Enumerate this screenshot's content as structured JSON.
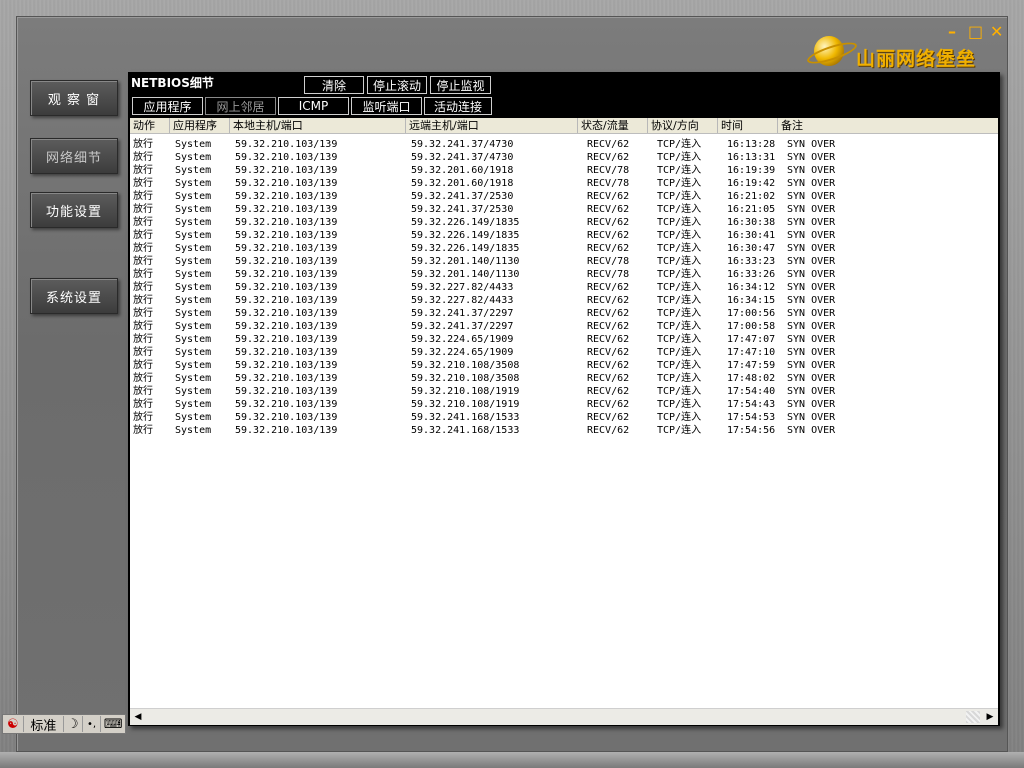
{
  "window": {
    "title_logo": "山丽网络堡垒",
    "controls": {
      "minimize": "–",
      "maximize": "□",
      "close": "✕"
    }
  },
  "sidebar": {
    "items": [
      {
        "label": "观 察 窗",
        "active": false
      },
      {
        "label": "网络细节",
        "active": true
      },
      {
        "label": "功能设置",
        "active": false
      },
      {
        "label": "系统设置",
        "active": false
      }
    ]
  },
  "panel": {
    "title": "NETBIOS细节",
    "toolbar": {
      "clear": "清除",
      "stop_scroll": "停止滚动",
      "stop_monitor": "停止监视"
    },
    "tabs": [
      "应用程序",
      "网上邻居",
      "ICMP",
      "监听端口",
      "活动连接"
    ],
    "columns": [
      "动作",
      "应用程序",
      "本地主机/端口",
      "远端主机/端口",
      "状态/流量",
      "协议/方向",
      "时间",
      "备注"
    ],
    "rows": [
      [
        "放行",
        "System",
        "59.32.210.103/139",
        "59.32.241.37/4730",
        "RECV/62",
        "TCP/连入",
        "16:13:28",
        "SYN OVER"
      ],
      [
        "放行",
        "System",
        "59.32.210.103/139",
        "59.32.241.37/4730",
        "RECV/62",
        "TCP/连入",
        "16:13:31",
        "SYN OVER"
      ],
      [
        "放行",
        "System",
        "59.32.210.103/139",
        "59.32.201.60/1918",
        "RECV/78",
        "TCP/连入",
        "16:19:39",
        "SYN OVER"
      ],
      [
        "放行",
        "System",
        "59.32.210.103/139",
        "59.32.201.60/1918",
        "RECV/78",
        "TCP/连入",
        "16:19:42",
        "SYN OVER"
      ],
      [
        "放行",
        "System",
        "59.32.210.103/139",
        "59.32.241.37/2530",
        "RECV/62",
        "TCP/连入",
        "16:21:02",
        "SYN OVER"
      ],
      [
        "放行",
        "System",
        "59.32.210.103/139",
        "59.32.241.37/2530",
        "RECV/62",
        "TCP/连入",
        "16:21:05",
        "SYN OVER"
      ],
      [
        "放行",
        "System",
        "59.32.210.103/139",
        "59.32.226.149/1835",
        "RECV/62",
        "TCP/连入",
        "16:30:38",
        "SYN OVER"
      ],
      [
        "放行",
        "System",
        "59.32.210.103/139",
        "59.32.226.149/1835",
        "RECV/62",
        "TCP/连入",
        "16:30:41",
        "SYN OVER"
      ],
      [
        "放行",
        "System",
        "59.32.210.103/139",
        "59.32.226.149/1835",
        "RECV/62",
        "TCP/连入",
        "16:30:47",
        "SYN OVER"
      ],
      [
        "放行",
        "System",
        "59.32.210.103/139",
        "59.32.201.140/1130",
        "RECV/78",
        "TCP/连入",
        "16:33:23",
        "SYN OVER"
      ],
      [
        "放行",
        "System",
        "59.32.210.103/139",
        "59.32.201.140/1130",
        "RECV/78",
        "TCP/连入",
        "16:33:26",
        "SYN OVER"
      ],
      [
        "放行",
        "System",
        "59.32.210.103/139",
        "59.32.227.82/4433",
        "RECV/62",
        "TCP/连入",
        "16:34:12",
        "SYN OVER"
      ],
      [
        "放行",
        "System",
        "59.32.210.103/139",
        "59.32.227.82/4433",
        "RECV/62",
        "TCP/连入",
        "16:34:15",
        "SYN OVER"
      ],
      [
        "放行",
        "System",
        "59.32.210.103/139",
        "59.32.241.37/2297",
        "RECV/62",
        "TCP/连入",
        "17:00:56",
        "SYN OVER"
      ],
      [
        "放行",
        "System",
        "59.32.210.103/139",
        "59.32.241.37/2297",
        "RECV/62",
        "TCP/连入",
        "17:00:58",
        "SYN OVER"
      ],
      [
        "放行",
        "System",
        "59.32.210.103/139",
        "59.32.224.65/1909",
        "RECV/62",
        "TCP/连入",
        "17:47:07",
        "SYN OVER"
      ],
      [
        "放行",
        "System",
        "59.32.210.103/139",
        "59.32.224.65/1909",
        "RECV/62",
        "TCP/连入",
        "17:47:10",
        "SYN OVER"
      ],
      [
        "放行",
        "System",
        "59.32.210.103/139",
        "59.32.210.108/3508",
        "RECV/62",
        "TCP/连入",
        "17:47:59",
        "SYN OVER"
      ],
      [
        "放行",
        "System",
        "59.32.210.103/139",
        "59.32.210.108/3508",
        "RECV/62",
        "TCP/连入",
        "17:48:02",
        "SYN OVER"
      ],
      [
        "放行",
        "System",
        "59.32.210.103/139",
        "59.32.210.108/1919",
        "RECV/62",
        "TCP/连入",
        "17:54:40",
        "SYN OVER"
      ],
      [
        "放行",
        "System",
        "59.32.210.103/139",
        "59.32.210.108/1919",
        "RECV/62",
        "TCP/连入",
        "17:54:43",
        "SYN OVER"
      ],
      [
        "放行",
        "System",
        "59.32.210.103/139",
        "59.32.241.168/1533",
        "RECV/62",
        "TCP/连入",
        "17:54:53",
        "SYN OVER"
      ],
      [
        "放行",
        "System",
        "59.32.210.103/139",
        "59.32.241.168/1533",
        "RECV/62",
        "TCP/连入",
        "17:54:56",
        "SYN OVER"
      ]
    ]
  },
  "scrollbar": {
    "left": "◀",
    "right": "▶"
  },
  "ime": {
    "icon": "☯",
    "mode": "标准",
    "moon": "☽",
    "punct": "•,",
    "keyboard": "⌨"
  },
  "colors": {
    "accent": "#f0b000",
    "panel_bg": "#000000",
    "list_bg": "#ffffff"
  }
}
